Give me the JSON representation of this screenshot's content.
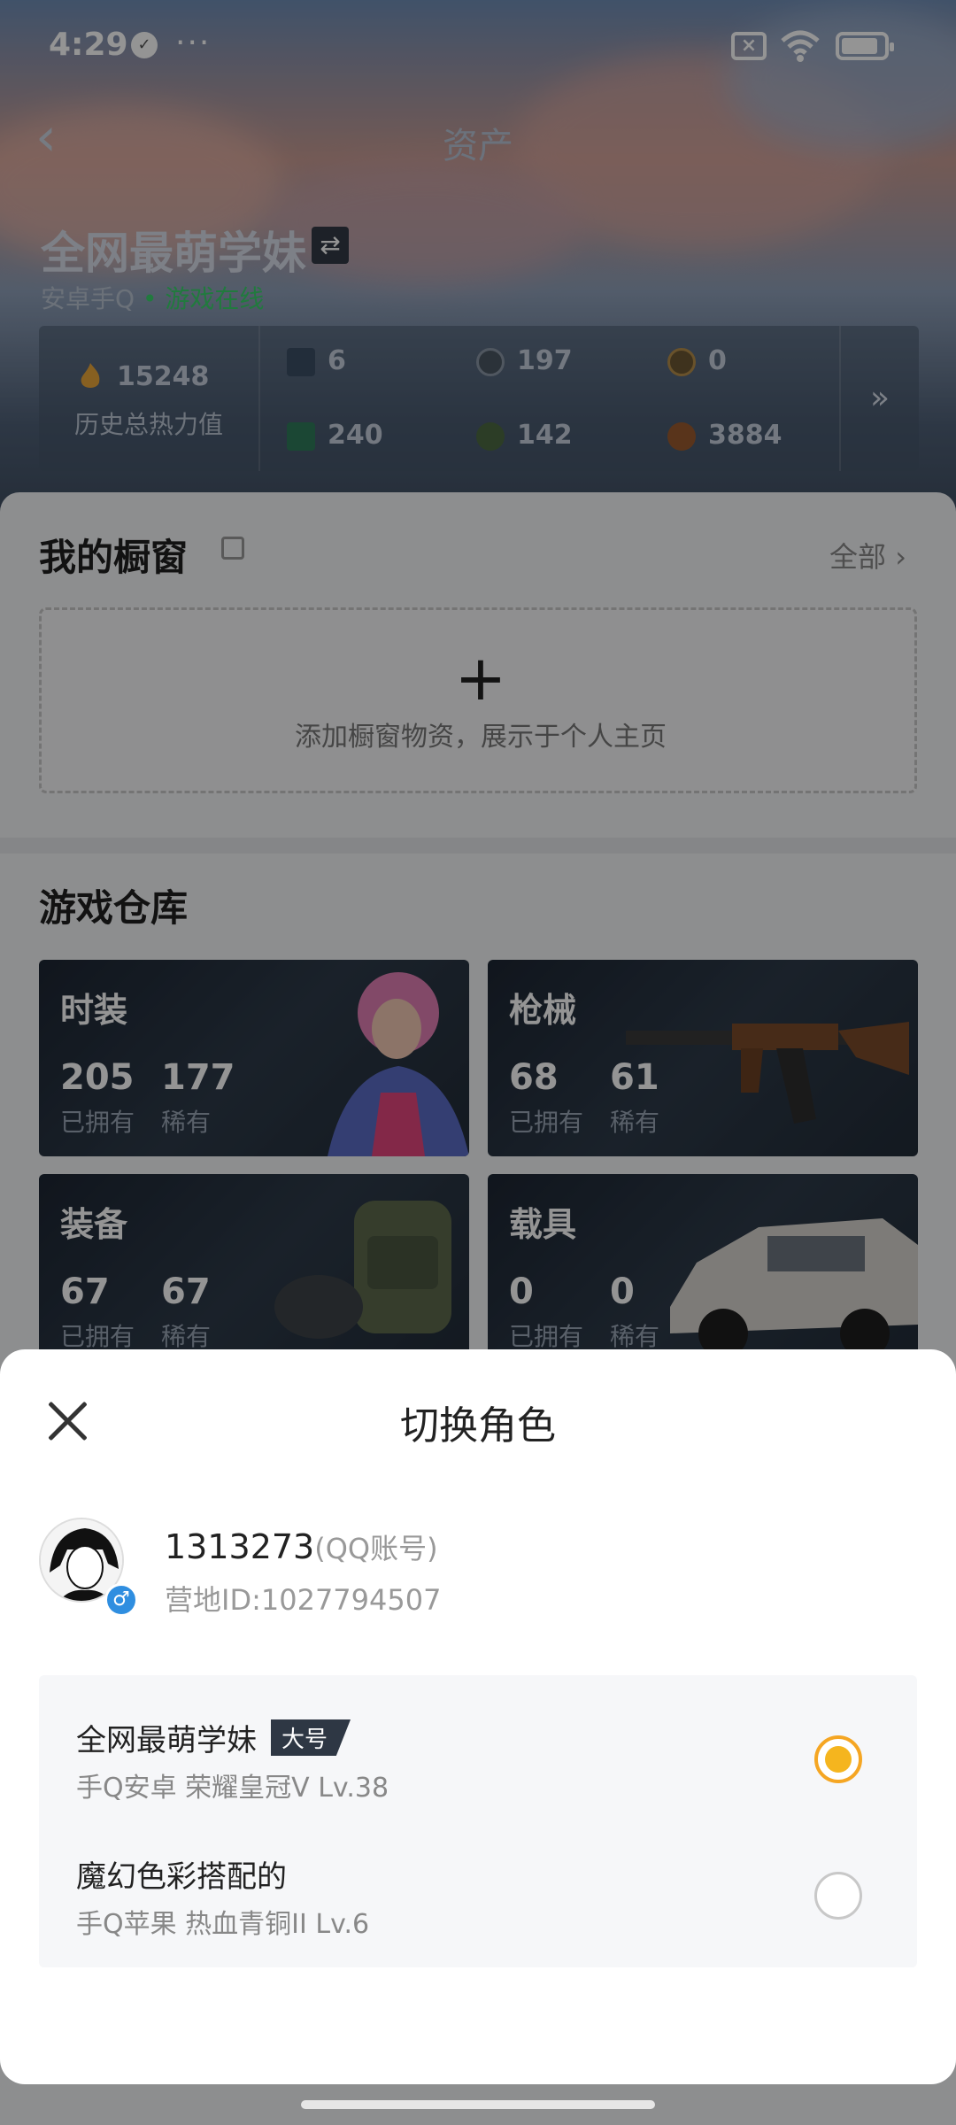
{
  "status_bar": {
    "time": "4:29",
    "dots": "···",
    "battery_icon": "battery-icon",
    "wifi_icon": "wifi-icon"
  },
  "header": {
    "back_icon": "chevron-left-icon",
    "title": "资产"
  },
  "profile": {
    "name": "全网最萌学妹",
    "swap_icon": "swap-icon",
    "platform": "安卓手Q",
    "status": "• 游戏在线",
    "heat_value": "15248",
    "heat_label": "历史总热力值"
  },
  "stats": [
    {
      "value": "6",
      "icon": "card-icon"
    },
    {
      "value": "197",
      "icon": "coin-icon"
    },
    {
      "value": "0",
      "icon": "badge-icon"
    },
    {
      "value": "240",
      "icon": "ticket-icon"
    },
    {
      "value": "142",
      "icon": "gem-icon"
    },
    {
      "value": "3884",
      "icon": "bronze-coin-icon"
    }
  ],
  "showcase": {
    "title": "我的橱窗",
    "all_label": "全部 ›",
    "add_hint": "添加橱窗物资，展示于个人主页"
  },
  "warehouse": {
    "title": "游戏仓库",
    "cards": [
      {
        "title": "时装",
        "owned": "205",
        "rare": "177",
        "owned_label": "已拥有",
        "rare_label": "稀有"
      },
      {
        "title": "枪械",
        "owned": "68",
        "rare": "61",
        "owned_label": "已拥有",
        "rare_label": "稀有"
      },
      {
        "title": "装备",
        "owned": "67",
        "rare": "67",
        "owned_label": "已拥有",
        "rare_label": "稀有"
      },
      {
        "title": "载具",
        "owned": "0",
        "rare": "0",
        "owned_label": "已拥有",
        "rare_label": "稀有"
      }
    ]
  },
  "sheet": {
    "title": "切换角色",
    "account": "1313273",
    "account_suffix": "(QQ账号)",
    "camp_id": "营地ID:1027794507",
    "roles": [
      {
        "name": "全网最萌学妹",
        "tag": "大号",
        "info": "手Q安卓  荣耀皇冠V  Lv.38",
        "selected": true
      },
      {
        "name": "魔幻色彩搭配的",
        "tag": "",
        "info": "手Q苹果  热血青铜II  Lv.6",
        "selected": false
      }
    ]
  }
}
